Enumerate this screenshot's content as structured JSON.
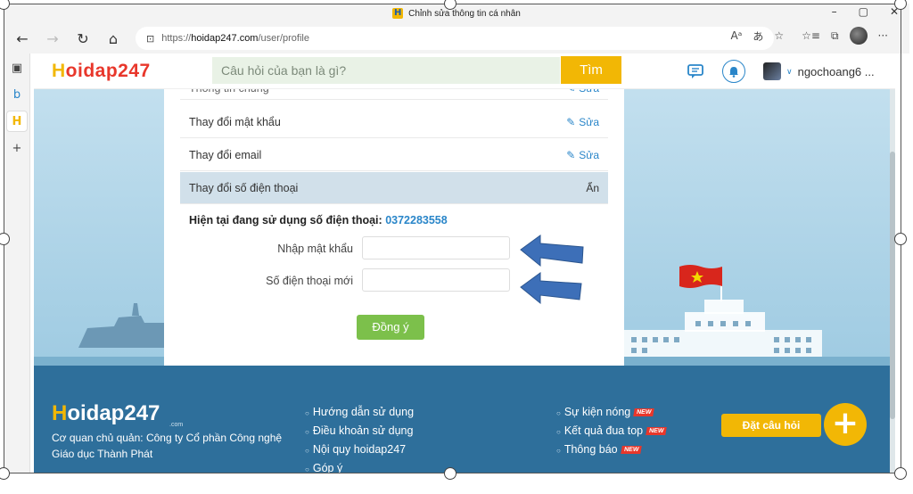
{
  "window": {
    "title": "Chỉnh sửa thông tin cá nhân",
    "controls": [
      "–",
      "▢",
      "✕"
    ]
  },
  "browser": {
    "url_prefix": "https://",
    "url_host": "hoidap247.com",
    "url_path": "/user/profile",
    "back_icon": "←",
    "forward_icon": "→",
    "reload_icon": "↻",
    "home_icon": "⌂",
    "lock_icon": "🔒",
    "read_aloud_icon": "A",
    "translate_icon": "あ",
    "favorite_icon": "☆",
    "favorites_icon": "★",
    "collections_icon": "⧉",
    "more_icon": "···"
  },
  "sidebar": {
    "tab_icon": "▣",
    "bing_icon": "b",
    "hoidap_icon": "H",
    "add_icon": "+"
  },
  "site": {
    "logo_h": "H",
    "logo_rest": "oidap247",
    "search_placeholder": "Câu hỏi của bạn là gì?",
    "search_button": "Tìm",
    "chat_icon": "▭",
    "bell_icon": "🔔",
    "username": "ngochoang6 ..."
  },
  "panel": {
    "rows": [
      {
        "label": "Thông tin chung",
        "action": "Sửa"
      },
      {
        "label": "Thay đổi mật khẩu",
        "action": "Sửa"
      },
      {
        "label": "Thay đổi email",
        "action": "Sửa"
      },
      {
        "label": "Thay đổi số điện thoại",
        "action": "Ẩn"
      }
    ],
    "edit_icon": "✎",
    "current_label": "Hiện tại đang sử dụng số điện thoại:",
    "current_phone": "0372283558",
    "password_label": "Nhập mật khẩu",
    "phone_label": "Số điện thoại mới",
    "submit": "Đồng ý"
  },
  "footer": {
    "logo_h": "H",
    "logo_rest": "oidap247",
    "logo_sub": ".com",
    "org": "Cơ quan chủ quản: Công ty Cổ phần Công nghệ Giáo dục Thành Phát",
    "links_col1": [
      "Hướng dẫn sử dụng",
      "Điều khoản sử dụng",
      "Nội quy hoidap247",
      "Góp ý"
    ],
    "links_col2": [
      "Sự kiện nóng",
      "Kết quả đua top",
      "Thông báo"
    ],
    "new_tag": "NEW",
    "ask_button": "Đặt câu hỏi",
    "plus_icon": "+"
  },
  "colors": {
    "brand_red": "#e8372b",
    "brand_yellow": "#f2b705",
    "link_blue": "#2a86c9",
    "footer_blue": "#2e6f9b",
    "button_green": "#7cc04b",
    "arrow_blue": "#3d6fb8"
  }
}
